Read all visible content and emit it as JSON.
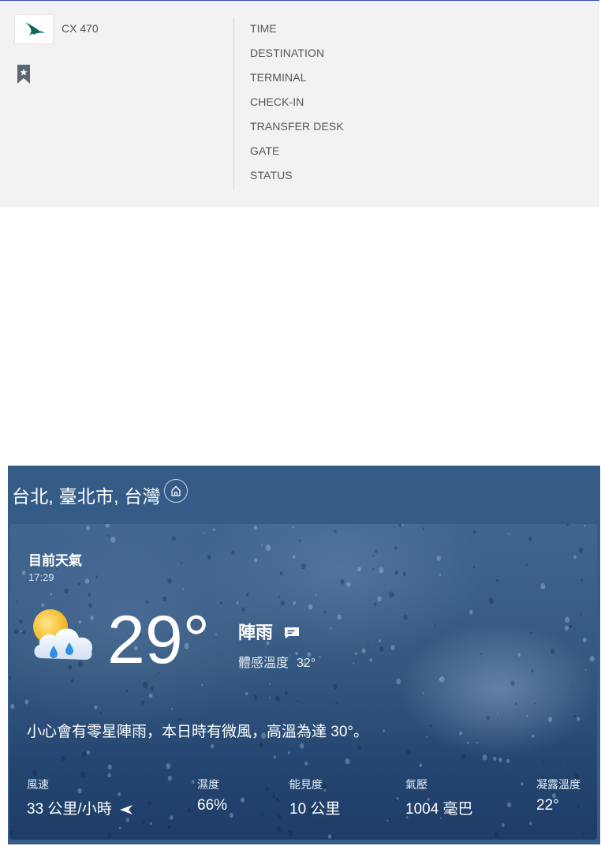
{
  "flight": {
    "airline_logo_icon": "cathay-pacific-logo",
    "flight_number": "CX 470",
    "bookmark_icon": "bookmark-star-icon",
    "fields": [
      "TIME",
      "DESTINATION",
      "TERMINAL",
      "CHECK-IN",
      "TRANSFER DESK",
      "GATE",
      "STATUS"
    ],
    "colors": {
      "card_bg": "#f2f2f2",
      "top_border": "#3b4cc7",
      "logo_green": "#0a6b5a"
    }
  },
  "weather": {
    "location": "台北, 臺北市, 台灣",
    "home_icon": "home-icon",
    "now_label": "目前天氣",
    "time": "17:29",
    "condition_icon": "cloud-sun-rain-icon",
    "temperature": "29°",
    "condition": "陣雨",
    "chat_icon": "message-icon",
    "feels_like_label": "體感溫度",
    "feels_like_value": "32°",
    "summary": "小心會有零星陣雨，本日時有微風，高溫為達 30°。",
    "stats": [
      {
        "label": "風速",
        "value": "33 公里/小時"
      },
      {
        "label": "濕度",
        "value": "66%"
      },
      {
        "label": "能見度",
        "value": "10 公里"
      },
      {
        "label": "氣壓",
        "value": "1004 毫巴"
      },
      {
        "label": "凝露溫度",
        "value": "22°"
      }
    ],
    "wind_direction_icon": "wind-direction-arrow-icon",
    "colors": {
      "header_bg": "#355c87",
      "panel_dark": "#1d3d66",
      "text": "#ffffff"
    }
  }
}
